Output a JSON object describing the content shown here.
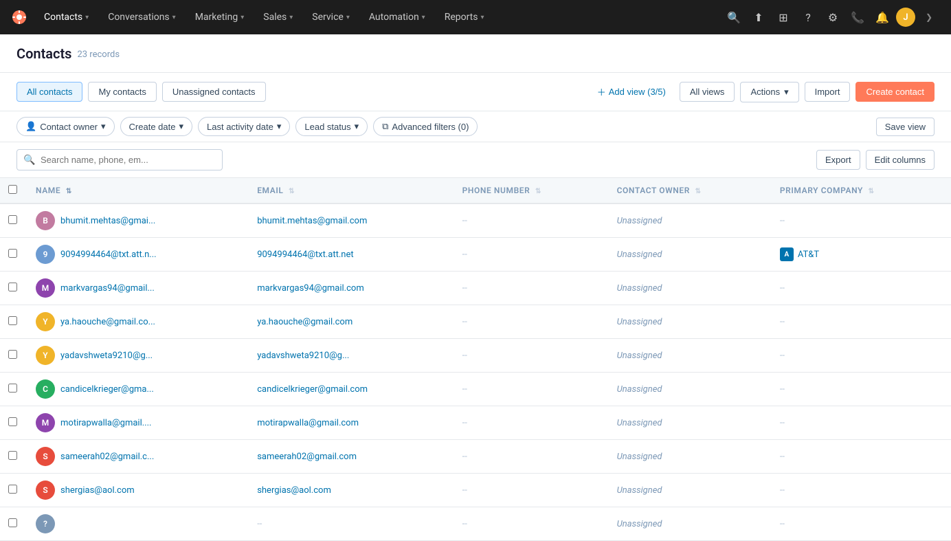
{
  "nav": {
    "logo_label": "HubSpot",
    "items": [
      {
        "id": "contacts",
        "label": "Contacts"
      },
      {
        "id": "conversations",
        "label": "Conversations"
      },
      {
        "id": "marketing",
        "label": "Marketing"
      },
      {
        "id": "sales",
        "label": "Sales"
      },
      {
        "id": "service",
        "label": "Service"
      },
      {
        "id": "automation",
        "label": "Automation"
      },
      {
        "id": "reports",
        "label": "Reports"
      }
    ],
    "search_placeholder": "Search HubSpot",
    "user_initials": "J"
  },
  "page": {
    "title": "Contacts",
    "records_count": "23 records",
    "tabs": [
      {
        "id": "all",
        "label": "All contacts",
        "active": true
      },
      {
        "id": "my",
        "label": "My contacts"
      },
      {
        "id": "unassigned",
        "label": "Unassigned contacts"
      }
    ]
  },
  "toolbar": {
    "add_view_label": "Add view (3/5)",
    "all_views_label": "All views",
    "actions_label": "Actions",
    "actions_chevron": "▾",
    "import_label": "Import",
    "create_contact_label": "Create contact"
  },
  "filters": {
    "contact_owner_label": "Contact owner",
    "create_date_label": "Create date",
    "last_activity_date_label": "Last activity date",
    "lead_status_label": "Lead status",
    "advanced_filters_label": "Advanced filters (0)",
    "save_view_label": "Save view"
  },
  "search": {
    "placeholder": "Search name, phone, em...",
    "export_label": "Export",
    "edit_columns_label": "Edit columns"
  },
  "table": {
    "columns": [
      {
        "id": "name",
        "label": "Name"
      },
      {
        "id": "email",
        "label": "Email"
      },
      {
        "id": "phone_number",
        "label": "Phone Number"
      },
      {
        "id": "contact_owner",
        "label": "Contact Owner"
      },
      {
        "id": "primary_company",
        "label": "Primary Company"
      }
    ],
    "rows": [
      {
        "id": 1,
        "initials": "B",
        "color": "#c27ba0",
        "name": "bhumit.mehtas@gmai...",
        "email": "bhumit.mehtas@gmail.com",
        "phone": "--",
        "owner": "Unassigned",
        "company": "--",
        "company_badge": false
      },
      {
        "id": 2,
        "initials": "9",
        "color": "#6c9bd2",
        "name": "9094994464@txt.att.n...",
        "email": "9094994464@txt.att.net",
        "phone": "--",
        "owner": "Unassigned",
        "company": "AT&T",
        "company_badge": true,
        "company_initials": "A",
        "company_color": "#0073ae"
      },
      {
        "id": 3,
        "initials": "M",
        "color": "#8e44ad",
        "name": "markvargas94@gmail...",
        "email": "markvargas94@gmail.com",
        "phone": "--",
        "owner": "Unassigned",
        "company": "--",
        "company_badge": false
      },
      {
        "id": 4,
        "initials": "Y",
        "color": "#f0b429",
        "name": "ya.haouche@gmail.co...",
        "email": "ya.haouche@gmail.com",
        "phone": "--",
        "owner": "Unassigned",
        "company": "--",
        "company_badge": false
      },
      {
        "id": 5,
        "initials": "Y",
        "color": "#f0b429",
        "name": "yadavshweta9210@g...",
        "email": "yadavshweta9210@g...",
        "phone": "--",
        "owner": "Unassigned",
        "company": "--",
        "company_badge": false
      },
      {
        "id": 6,
        "initials": "C",
        "color": "#27ae60",
        "name": "candicelkrieger@gma...",
        "email": "candicelkrieger@gmail.com",
        "phone": "--",
        "owner": "Unassigned",
        "company": "--",
        "company_badge": false
      },
      {
        "id": 7,
        "initials": "M",
        "color": "#8e44ad",
        "name": "motirapwalla@gmail....",
        "email": "motirapwalla@gmail.com",
        "phone": "--",
        "owner": "Unassigned",
        "company": "--",
        "company_badge": false
      },
      {
        "id": 8,
        "initials": "S",
        "color": "#e74c3c",
        "name": "sameerah02@gmail.c...",
        "email": "sameerah02@gmail.com",
        "phone": "--",
        "owner": "Unassigned",
        "company": "--",
        "company_badge": false
      },
      {
        "id": 9,
        "initials": "S",
        "color": "#e74c3c",
        "name": "shergias@aol.com",
        "email": "shergias@aol.com",
        "phone": "--",
        "owner": "Unassigned",
        "company": "--",
        "company_badge": false
      },
      {
        "id": 10,
        "initials": "?",
        "color": "#7c98b6",
        "name": "",
        "email": "",
        "phone": "--",
        "owner": "Unassigned",
        "company": "--",
        "company_badge": false
      }
    ]
  },
  "colors": {
    "accent": "#ff7a59",
    "link": "#0073ae",
    "bg_light": "#f5f8fa",
    "border": "#e5e8eb",
    "text_muted": "#7c98b6",
    "nav_bg": "#1d1d1d"
  }
}
